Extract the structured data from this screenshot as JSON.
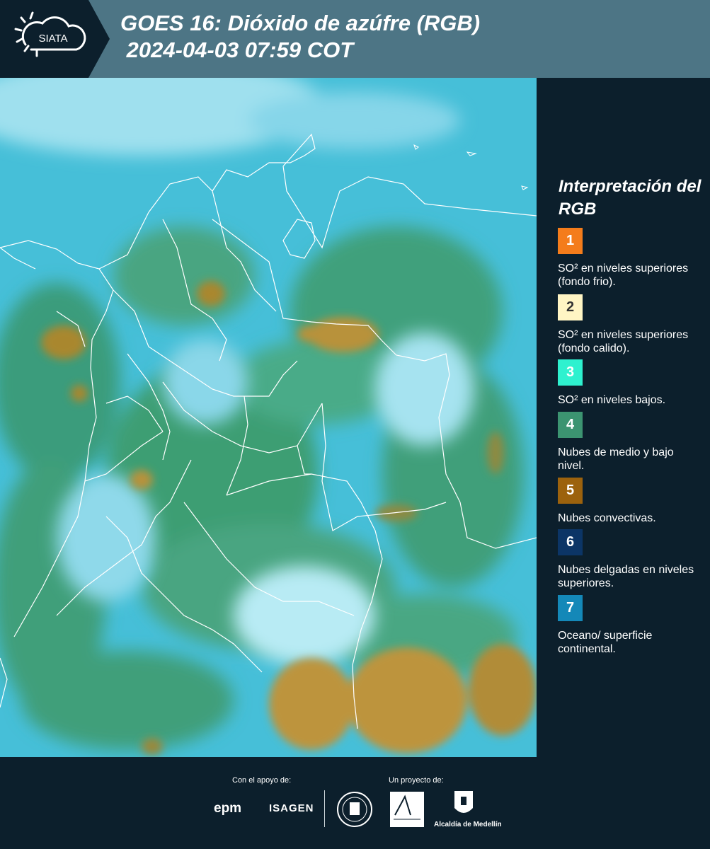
{
  "header": {
    "logo_text": "SIATA",
    "title": "GOES 16: Dióxido de azúfre (RGB)\n 2024-04-03 07:59 COT"
  },
  "legend": {
    "title": "Interpretación del RGB",
    "items": [
      {
        "number": "1",
        "color": "#f47c1b",
        "text_color": "#ffffff",
        "description": "SO² en niveles superiores (fondo frio)."
      },
      {
        "number": "2",
        "color": "#fff5c4",
        "text_color": "#333333",
        "description": "SO² en niveles superiores (fondo calido)."
      },
      {
        "number": "3",
        "color": "#2ef1cf",
        "text_color": "#ffffff",
        "description": "SO² en niveles bajos."
      },
      {
        "number": "4",
        "color": "#3c9471",
        "text_color": "#ffffff",
        "description": "Nubes de medio y bajo nivel."
      },
      {
        "number": "5",
        "color": "#9c620d",
        "text_color": "#ffffff",
        "description": "Nubes convectivas."
      },
      {
        "number": "6",
        "color": "#0c3566",
        "text_color": "#ffffff",
        "description": "Nubes delgadas en niveles superiores."
      },
      {
        "number": "7",
        "color": "#1488b8",
        "text_color": "#ffffff",
        "description": "Oceano/ superficie continental."
      }
    ]
  },
  "footer": {
    "support_label": "Con el apoyo de:",
    "project_label": "Un proyecto de:",
    "epm": "epm",
    "isagen": "ISAGEN",
    "alcaldia": "Alcaldía de Medellín"
  }
}
